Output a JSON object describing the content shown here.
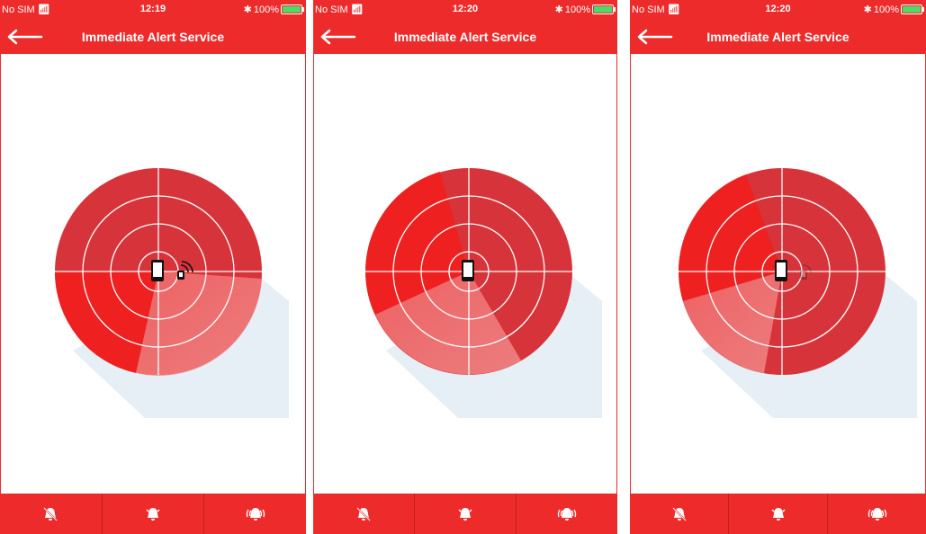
{
  "screens": [
    {
      "status": {
        "carrier": "No SIM",
        "time": "12:19",
        "battery": "100%"
      },
      "title": "Immediate Alert Service",
      "radar": {
        "sweep_start_deg": 200,
        "sweep_end_deg": 280,
        "device_visible": true
      }
    },
    {
      "status": {
        "carrier": "No SIM",
        "time": "12:20",
        "battery": "100%"
      },
      "title": "Immediate Alert Service",
      "radar": {
        "sweep_start_deg": 115,
        "sweep_end_deg": 240,
        "device_visible": false
      }
    },
    {
      "status": {
        "carrier": "No SIM",
        "time": "12:20",
        "battery": "100%"
      },
      "title": "Immediate Alert Service",
      "radar": {
        "sweep_start_deg": 40,
        "sweep_end_deg": 180,
        "device_visible": true,
        "device_faded": true
      }
    }
  ],
  "tabs": [
    {
      "icon": "bell-off-icon"
    },
    {
      "icon": "bell-mild-alert-icon"
    },
    {
      "icon": "bell-high-alert-icon"
    }
  ],
  "colors": {
    "primary": "#ee2b2b",
    "radar_base": "#d6343a",
    "battery": "#4cd964"
  }
}
